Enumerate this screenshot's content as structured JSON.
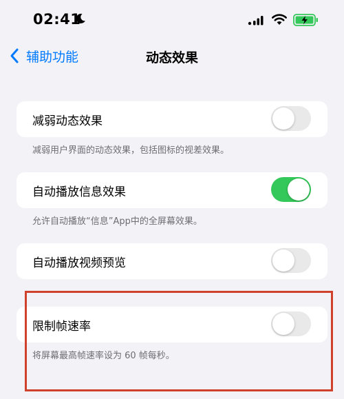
{
  "status_bar": {
    "time": "02:41",
    "icons": [
      "moon-icon",
      "cellular-signal-icon",
      "wifi-icon",
      "battery-charging-icon"
    ]
  },
  "nav": {
    "back_label": "辅助功能",
    "title": "动态效果"
  },
  "settings": [
    {
      "label": "减弱动态效果",
      "on": false,
      "footer": "减弱用户界面的动态效果，包括图标的视差效果。"
    },
    {
      "label": "自动播放信息效果",
      "on": true,
      "footer": "允许自动播放“信息”App中的全屏幕效果。"
    },
    {
      "label": "自动播放视频预览",
      "on": false
    },
    {
      "label": "限制帧速率",
      "on": false,
      "footer": "将屏幕最高帧速率设为 60 帧每秒。"
    }
  ],
  "colors": {
    "accent": "#007aff",
    "toggle_on": "#34c759",
    "toggle_off": "#e9e9ea",
    "battery": "#34c759",
    "highlight_border": "#d0412b",
    "background": "#f2f2f7"
  }
}
